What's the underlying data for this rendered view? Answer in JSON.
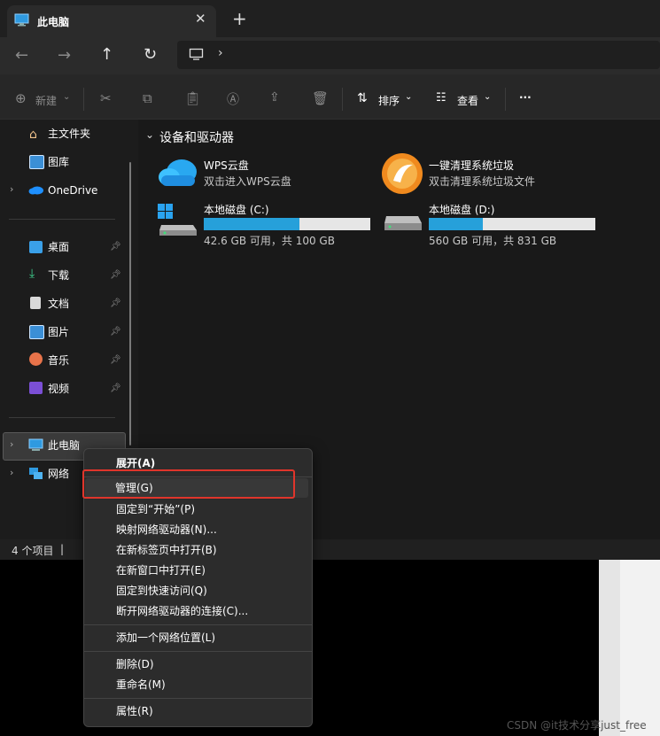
{
  "tab": {
    "title": "此电脑"
  },
  "toolbar": {
    "new": "新建",
    "sort": "排序",
    "view": "查看",
    "more": "···"
  },
  "sidebar": {
    "home": "主文件夹",
    "gallery": "图库",
    "onedrive": "OneDrive",
    "quick": [
      {
        "label": "桌面"
      },
      {
        "label": "下载"
      },
      {
        "label": "文档"
      },
      {
        "label": "图片"
      },
      {
        "label": "音乐"
      },
      {
        "label": "视频"
      }
    ],
    "pc": "此电脑",
    "network": "网络"
  },
  "content": {
    "section": "设备和驱动器",
    "apps": [
      {
        "name": "WPS云盘",
        "desc": "双击进入WPS云盘"
      },
      {
        "name": "一键清理系统垃圾",
        "desc": "双击清理系统垃圾文件"
      }
    ],
    "drives": [
      {
        "name": "本地磁盘 (C:)",
        "space": "42.6 GB 可用，共 100 GB",
        "used_fraction": 0.574
      },
      {
        "name": "本地磁盘 (D:)",
        "space": "560 GB 可用，共 831 GB",
        "used_fraction": 0.326
      }
    ]
  },
  "status": {
    "count": "4 个项目",
    "sep": "|"
  },
  "menu": [
    "展开(A)",
    "管理(G)",
    "固定到“开始”(P)",
    "映射网络驱动器(N)...",
    "在新标签页中打开(B)",
    "在新窗口中打开(E)",
    "固定到快速访问(Q)",
    "断开网络驱动器的连接(C)...",
    "添加一个网络位置(L)",
    "删除(D)",
    "重命名(M)",
    "属性(R)"
  ],
  "watermark": "CSDN @it技术分享just_free",
  "colors": {
    "accent": "#26a0da",
    "highlight_box": "#e0352b"
  }
}
